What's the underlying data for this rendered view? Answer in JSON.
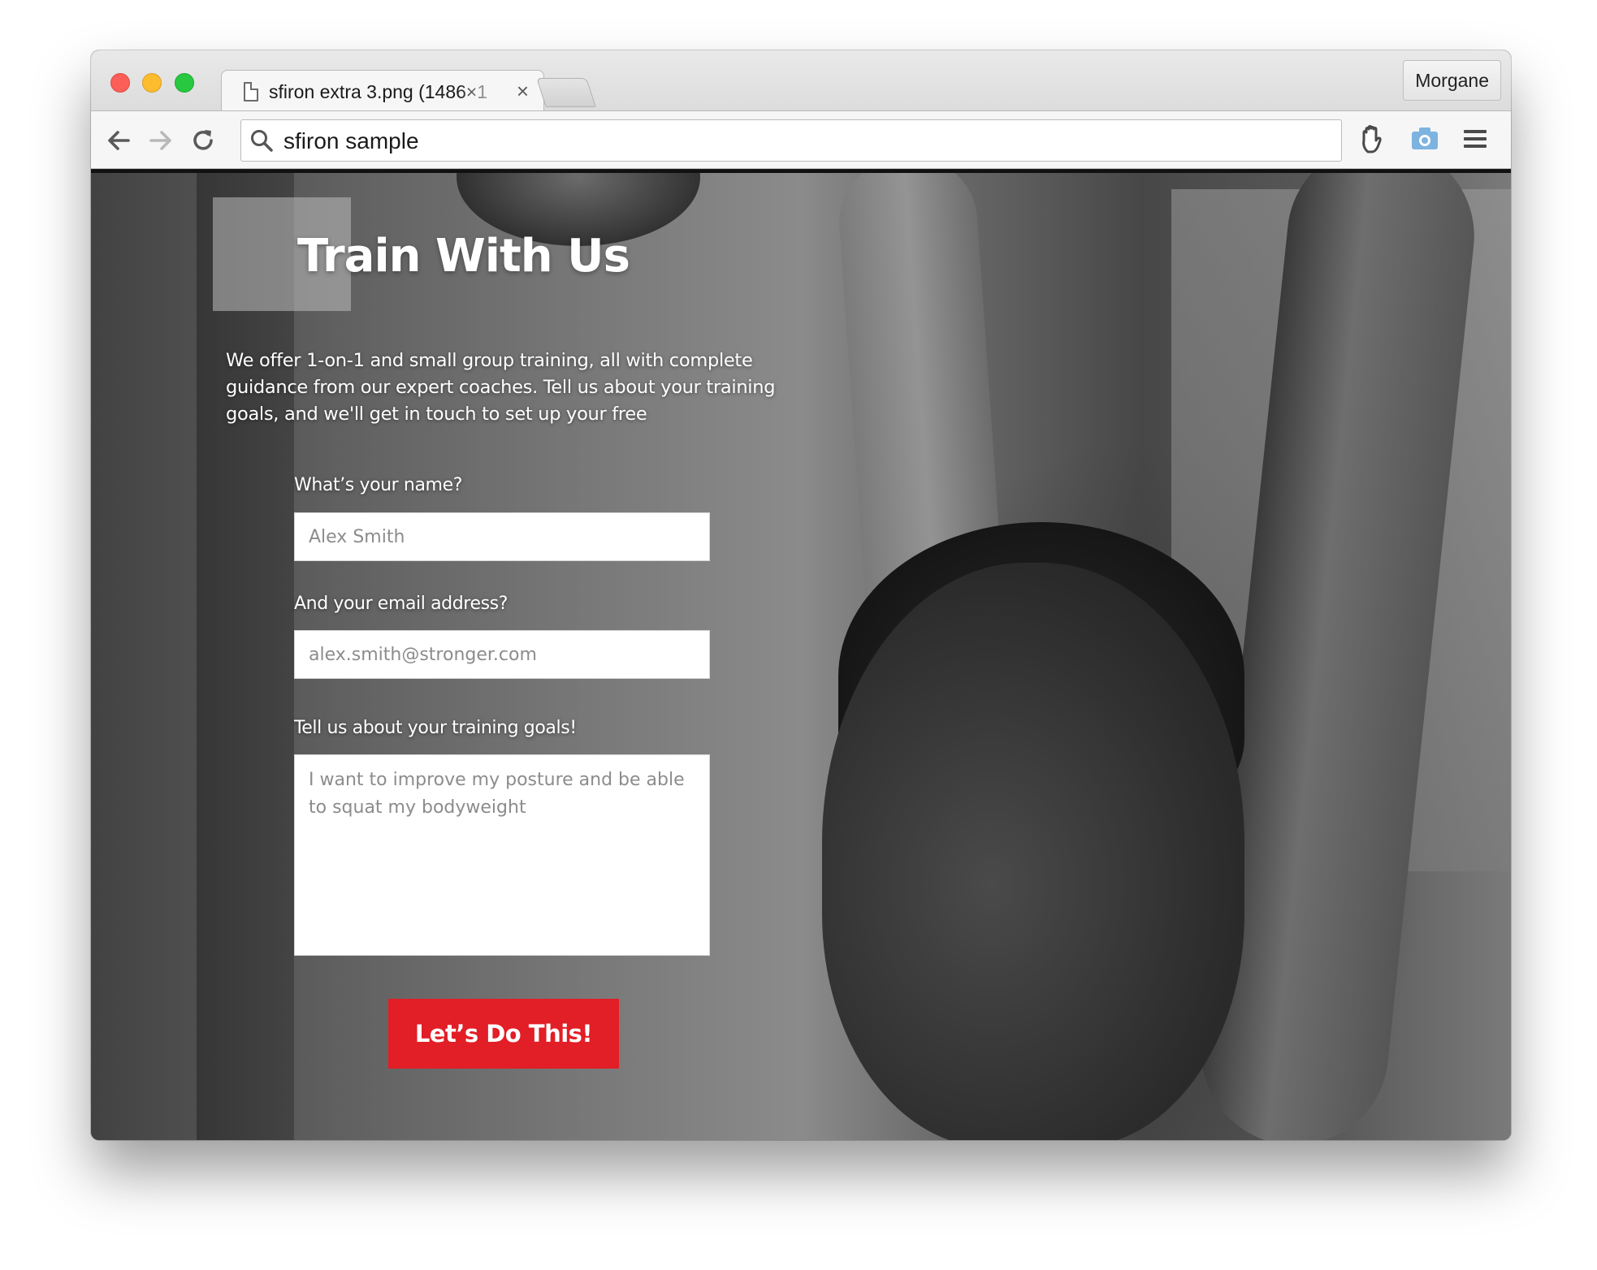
{
  "browser": {
    "tab_title": "sfiron extra 3.png (1486×1",
    "tab_close": "×",
    "profile_name": "Morgane",
    "address_query": "sfiron sample",
    "icons": {
      "back": "arrow-left-icon",
      "forward": "arrow-right-icon",
      "reload": "reload-icon",
      "search": "search-icon",
      "extension_1": "hand-stop-icon",
      "extension_2": "camera-icon",
      "menu": "hamburger-menu-icon",
      "tab_favicon": "file-icon"
    }
  },
  "page": {
    "title": "Train With Us",
    "intro": "We offer 1-on-1 and small group training, all with complete guidance from our expert coaches. Tell us about your training goals, and we'll get in touch to set up your free",
    "form": {
      "name_label": "What’s your name?",
      "name_placeholder": "Alex Smith",
      "email_label": "And your email address?",
      "email_placeholder": "alex.smith@stronger.com",
      "goals_label": "Tell us about your training goals!",
      "goals_placeholder": "I want to improve my posture and be able to squat my bodyweight",
      "submit_label": "Let’s Do This!"
    }
  },
  "colors": {
    "cta": "#e21e26",
    "traffic_close": "#fc5f57",
    "traffic_minimize": "#fdbb2e",
    "traffic_maximize": "#28c840",
    "camera_extension": "#7db3e0"
  }
}
